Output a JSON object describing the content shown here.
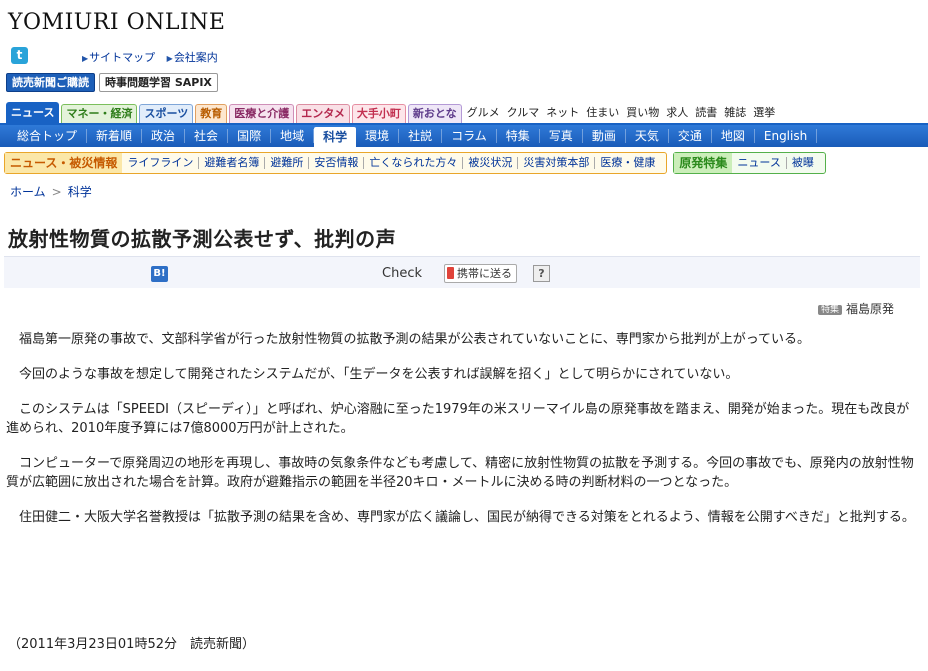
{
  "header": {
    "logo": "YOMIURI ONLINE",
    "top_links": [
      "サイトマップ",
      "会社案内"
    ],
    "subscribe_button": "読売新聞ご購読",
    "sapix_button": "時事問題学習 SAPIX"
  },
  "category_tabs": [
    {
      "label": "ニュース",
      "bg": "#1862c4",
      "fg": "#ffffff",
      "border": "#1862c4",
      "active": true
    },
    {
      "label": "マネー・経済",
      "bg": "#e4f3da",
      "fg": "#2e7d1a",
      "border": "#7bbf5c"
    },
    {
      "label": "スポーツ",
      "bg": "#e2edfa",
      "fg": "#1a4fa0",
      "border": "#7fa6d8"
    },
    {
      "label": "教育",
      "bg": "#fde7cf",
      "fg": "#b85c00",
      "border": "#e1a060"
    },
    {
      "label": "医療と介護",
      "bg": "#f6e3ef",
      "fg": "#8a2b65",
      "border": "#cf8fb8"
    },
    {
      "label": "エンタメ",
      "bg": "#f9e0e6",
      "fg": "#b3264c",
      "border": "#dc8ea2"
    },
    {
      "label": "大手小町",
      "bg": "#fde6ea",
      "fg": "#c23050",
      "border": "#e68ea2"
    },
    {
      "label": "新おとな",
      "bg": "#efe7f7",
      "fg": "#5d3a8a",
      "border": "#b49ad6"
    },
    {
      "label": "グルメ",
      "plain": true
    },
    {
      "label": "クルマ",
      "plain": true
    },
    {
      "label": "ネット",
      "plain": true
    },
    {
      "label": "住まい",
      "plain": true
    },
    {
      "label": "買い物",
      "plain": true
    },
    {
      "label": "求人",
      "plain": true
    },
    {
      "label": "読書",
      "plain": true
    },
    {
      "label": "雑誌",
      "plain": true
    },
    {
      "label": "選挙",
      "plain": true
    }
  ],
  "nav_items": [
    {
      "label": "総合トップ"
    },
    {
      "label": "新着順"
    },
    {
      "label": "政治"
    },
    {
      "label": "社会"
    },
    {
      "label": "国際"
    },
    {
      "label": "地域"
    },
    {
      "label": "科学",
      "selected": true
    },
    {
      "label": "環境"
    },
    {
      "label": "社説"
    },
    {
      "label": "コラム"
    },
    {
      "label": "特集"
    },
    {
      "label": "写真"
    },
    {
      "label": "動画"
    },
    {
      "label": "天気"
    },
    {
      "label": "交通"
    },
    {
      "label": "地図"
    },
    {
      "label": "English"
    }
  ],
  "disaster_nav": {
    "head": "ニュース・被災情報",
    "items": [
      "ライフライン",
      "避難者名簿",
      "避難所",
      "安否情報",
      "亡くなられた方々",
      "被災状況",
      "災害対策本部",
      "医療・健康"
    ]
  },
  "nuclear_nav": {
    "head": "原発特集",
    "items": [
      "ニュース",
      "被曝"
    ]
  },
  "breadcrumb": {
    "home": "ホーム",
    "separator": ">",
    "current": "科学"
  },
  "article": {
    "headline": "放射性物質の拡散予測公表せず、批判の声",
    "tag_badge": "特集",
    "tag_label": "福島原発",
    "paragraphs": [
      "福島第一原発の事故で、文部科学省が行った放射性物質の拡散予測の結果が公表されていないことに、専門家から批判が上がっている。",
      "今回のような事故を想定して開発されたシステムだが、「生データを公表すれば誤解を招く」として明らかにされていない。",
      "このシステムは「SPEEDI（スピーディ）」と呼ばれ、炉心溶融に至った1979年の米スリーマイル島の原発事故を踏まえ、開発が始まった。現在も改良が進められ、2010年度予算には7億8000万円が計上された。",
      "コンピューターで原発周辺の地形を再現し、事故時の気象条件なども考慮して、精密に放射性物質の拡散を予測する。今回の事故でも、原発内の放射性物質が広範囲に放出された場合を計算。政府が避難指示の範囲を半径20キロ・メートルに決める時の判断材料の一つとなった。",
      "住田健二・大阪大学名誉教授は「拡散予測の結果を含め、専門家が広く議論し、国民が納得できる対策をとれるよう、情報を公開すべきだ」と批判する。"
    ],
    "byline": "（2011年3月23日01時52分　読売新聞）"
  },
  "social": {
    "hatena_label": "B!",
    "check_label": "Check",
    "mobile_label": "携帯に送る",
    "help_label": "?"
  },
  "icons": {
    "twitter": "twitter-icon",
    "hatena": "hatena-bookmark-icon",
    "phone": "mobile-phone-icon"
  }
}
